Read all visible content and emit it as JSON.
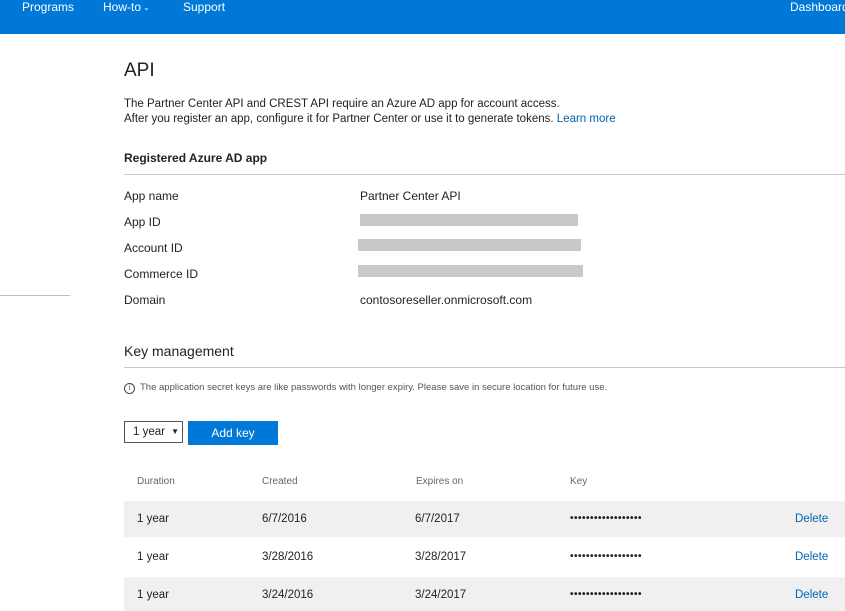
{
  "nav": {
    "programs": "Programs",
    "howto": "How-to",
    "support": "Support",
    "dashboard": "Dashboard"
  },
  "page": {
    "title": "API",
    "desc_line1": "The Partner Center API and CREST API require an Azure AD app for account access.",
    "desc_line2": "After you register an app, configure it for Partner Center or use it to generate tokens.",
    "learn_more": "Learn more"
  },
  "registered": {
    "heading": "Registered Azure AD app",
    "app_name_label": "App name",
    "app_name_value": "Partner Center API",
    "app_id_label": "App ID",
    "account_id_label": "Account ID",
    "commerce_id_label": "Commerce ID",
    "domain_label": "Domain",
    "domain_value": "contosoreseller.onmicrosoft.com"
  },
  "key_management": {
    "heading": "Key management",
    "info": "The application secret keys are like passwords with longer expiry. Please save in secure location for future use.",
    "duration_selected": "1 year",
    "add_key_label": "Add key",
    "columns": [
      "Duration",
      "Created",
      "Expires on",
      "Key"
    ],
    "rows": [
      {
        "duration": "1 year",
        "created": "6/7/2016",
        "expires": "6/7/2017",
        "key": "••••••••••••••••••",
        "action": "Delete"
      },
      {
        "duration": "1 year",
        "created": "3/28/2016",
        "expires": "3/28/2017",
        "key": "••••••••••••••••••",
        "action": "Delete"
      },
      {
        "duration": "1 year",
        "created": "3/24/2016",
        "expires": "3/24/2017",
        "key": "••••••••••••••••••",
        "action": "Delete"
      }
    ]
  }
}
